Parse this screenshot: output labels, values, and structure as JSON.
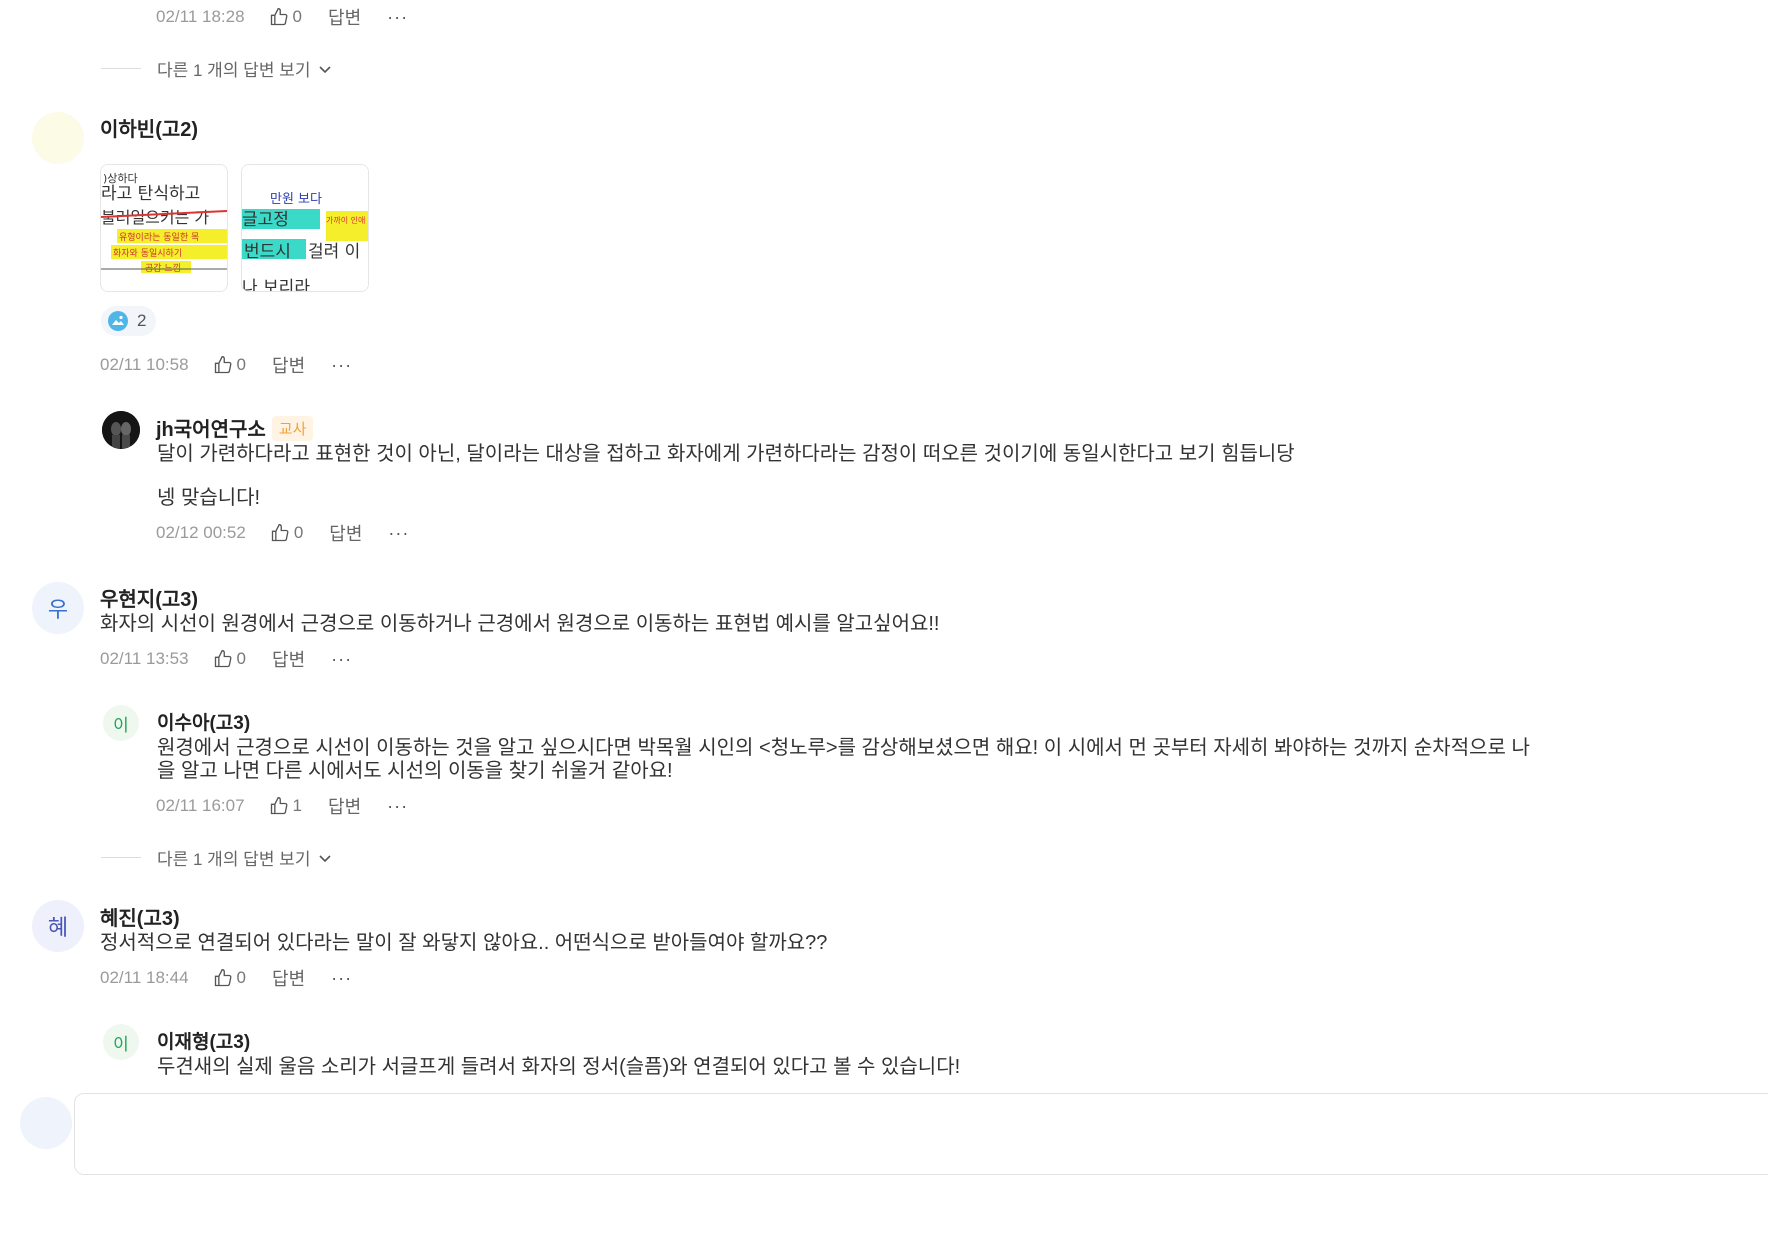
{
  "comment_top_reply": {
    "time": "02/11 18:28",
    "likes": "0",
    "reply_label": "답변",
    "more_label": "···"
  },
  "expand1": {
    "label": "다른 1 개의 답변 보기"
  },
  "comment_habin": {
    "author": "이하빈(고2)",
    "images": {
      "img1_text": "라고 탄식하고",
      "img1_text2": "불러일으키는 가",
      "img1_note": "유형이라는 동일한 목",
      "img1_note2": "화자와 동일시하기",
      "img2_top": "만원 보다",
      "img2_text": "글고정",
      "img2_text2": "번드시",
      "img2_text3": "걸려 이",
      "img2_note": "가까이 인애",
      "count": "2"
    },
    "time": "02/11 10:58",
    "likes": "0",
    "reply_label": "답변",
    "more_label": "···"
  },
  "reply_jh": {
    "author": "jh국어연구소",
    "badge": "교사",
    "text1": "달이 가련하다라고 표현한 것이 아닌, 달이라는 대상을 접하고 화자에게 가련하다라는 감정이 떠오른 것이기에 동일시한다고 보기 힘듭니당",
    "text2": "넹 맞습니다!",
    "time": "02/12 00:52",
    "likes": "0",
    "reply_label": "답변",
    "more_label": "···"
  },
  "comment_hyunji": {
    "avatar_letter": "우",
    "author": "우현지(고3)",
    "text": "화자의 시선이 원경에서 근경으로 이동하거나 근경에서 원경으로 이동하는 표현법 예시를 알고싶어요!!",
    "time": "02/11 13:53",
    "likes": "0",
    "reply_label": "답변",
    "more_label": "···"
  },
  "reply_sua": {
    "avatar_letter": "이",
    "author": "이수아(고3)",
    "text1": "원경에서 근경으로 시선이 이동하는 것을 알고 싶으시다면 박목월 시인의 <청노루>를 감상해보셨으면 해요! 이 시에서 먼 곳부터 자세히 봐야하는 것까지 순차적으로 나",
    "text2": "을 알고 나면 다른 시에서도 시선의 이동을 찾기 쉬울거 같아요!",
    "time": "02/11 16:07",
    "likes": "1",
    "reply_label": "답변",
    "more_label": "···"
  },
  "expand2": {
    "label": "다른 1 개의 답변 보기"
  },
  "comment_hyejin": {
    "avatar_letter": "혜",
    "author": "혜진(고3)",
    "text": "정서적으로 연결되어 있다라는 말이 잘 와닿지 않아요.. 어떤식으로 받아들여야 할까요??",
    "time": "02/11 18:44",
    "likes": "0",
    "reply_label": "답변",
    "more_label": "···"
  },
  "reply_jaehyung": {
    "avatar_letter": "이",
    "author": "이재형(고3)",
    "text": "두견새의 실제 울음 소리가 서글프게 들려서 화자의 정서(슬픔)와 연결되어 있다고 볼 수 있습니다!"
  },
  "colors": {
    "accent_green": "#1fa35b",
    "accent_blue": "#3b6fd0",
    "badge_orange": "#f0a23a"
  }
}
